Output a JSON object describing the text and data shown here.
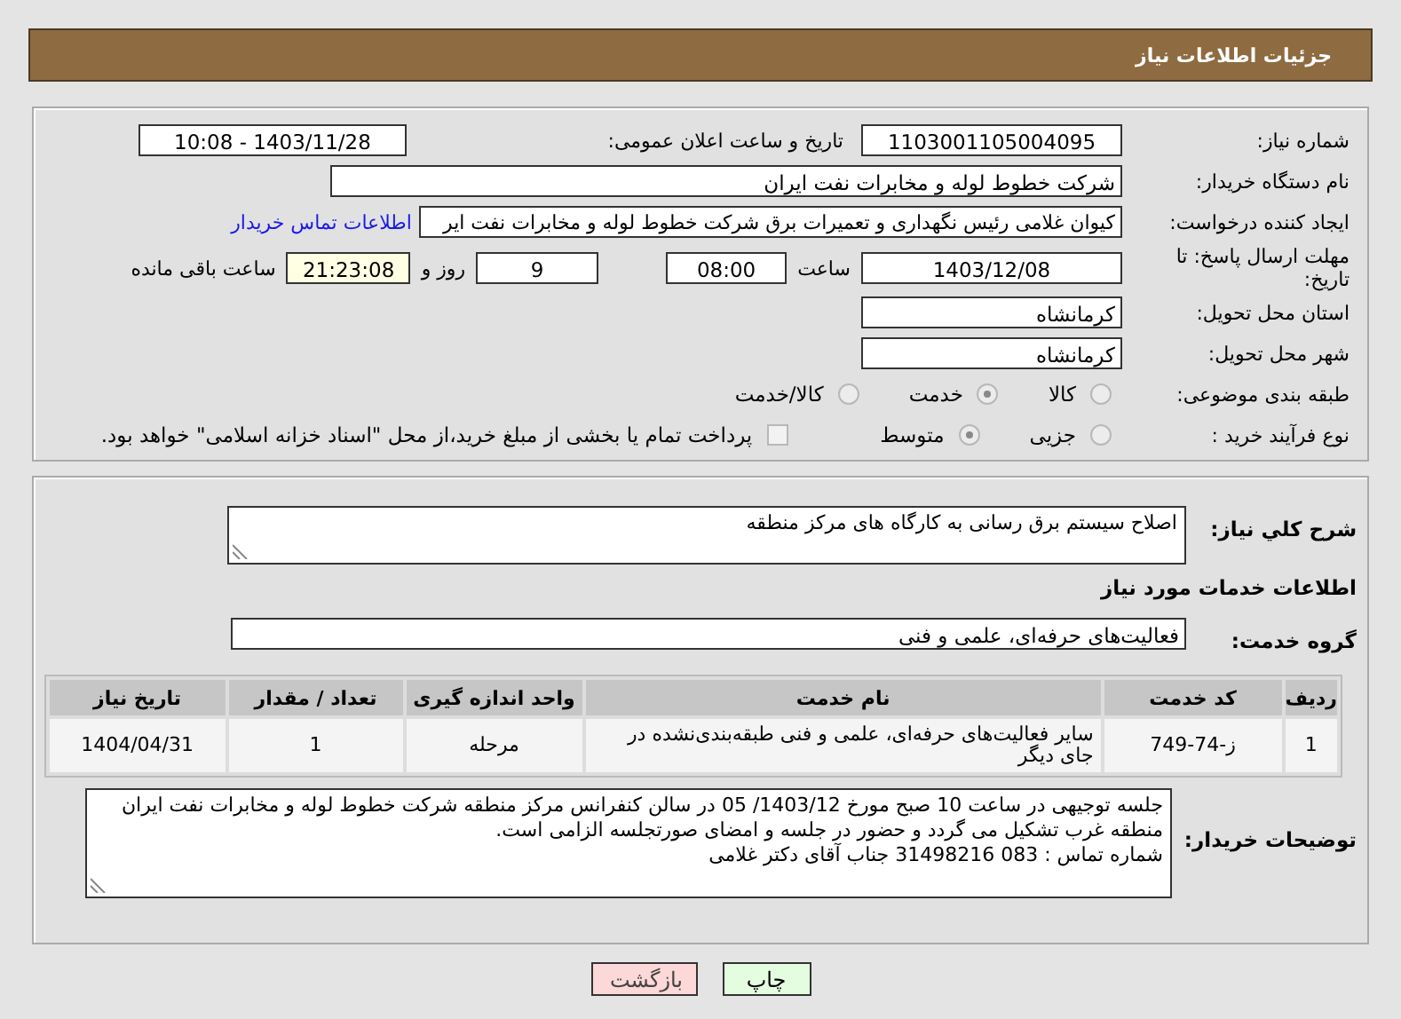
{
  "header": {
    "title": "جزئیات اطلاعات نیاز"
  },
  "need_number": {
    "label": "شماره نیاز:",
    "value": "1103001105004095"
  },
  "announce": {
    "label": "تاریخ و ساعت اعلان عمومی:",
    "value": "1403/11/28 - 10:08"
  },
  "buyer_org": {
    "label": "نام دستگاه خریدار:",
    "value": "شرکت خطوط لوله و مخابرات نفت ایران"
  },
  "requester": {
    "label": "ایجاد کننده درخواست:",
    "value": "کیوان غلامی رئیس نگهداری و تعمیرات برق شرکت خطوط لوله و مخابرات نفت ایر",
    "link": "اطلاعات تماس خریدار"
  },
  "deadline": {
    "label": "مهلت ارسال پاسخ: تا تاریخ:",
    "date": "1403/12/08",
    "time_label": "ساعت",
    "time": "08:00",
    "days": "9",
    "days_label": "روز و",
    "remaining": "21:23:08",
    "remaining_label": "ساعت باقی مانده"
  },
  "province": {
    "label": "استان محل تحویل:",
    "value": "کرمانشاه"
  },
  "city": {
    "label": "شهر محل تحویل:",
    "value": "کرمانشاه"
  },
  "category": {
    "label": "طبقه بندی موضوعی:",
    "options": [
      {
        "label": "کالا",
        "selected": false
      },
      {
        "label": "خدمت",
        "selected": true
      },
      {
        "label": "کالا/خدمت",
        "selected": false
      }
    ]
  },
  "process": {
    "label": "نوع فرآیند خرید :",
    "options": [
      {
        "label": "جزیی",
        "selected": false
      },
      {
        "label": "متوسط",
        "selected": true
      }
    ],
    "treasury": {
      "checked": false,
      "text": "پرداخت تمام یا بخشی از مبلغ خرید،از محل \"اسناد خزانه اسلامی\" خواهد بود."
    }
  },
  "summary": {
    "label": "شرح کلي نياز:",
    "value": "اصلاح سیستم برق رسانی به کارگاه های مرکز منطقه"
  },
  "services_heading": "اطلاعات خدمات مورد نیاز",
  "service_group": {
    "label": "گروه خدمت:",
    "value": "فعالیت‌های حرفه‌ای، علمی و فنی"
  },
  "table": {
    "columns": [
      "ردیف",
      "کد خدمت",
      "نام خدمت",
      "واحد اندازه گیری",
      "تعداد / مقدار",
      "تاریخ نیاز"
    ],
    "rows": [
      [
        "1",
        "ز-74-749",
        "سایر فعالیت‌های حرفه‌ای، علمی و فنی طبقه‌بندی‌نشده در جای دیگر",
        "مرحله",
        "1",
        "1404/04/31"
      ]
    ]
  },
  "buyer_notes": {
    "label": "توضیحات خریدار:",
    "value": "جلسه توجیهی در ساعت 10 صبح مورخ 1403/12/ 05 در سالن کنفرانس مرکز منطقه شرکت خطوط لوله و مخابرات نفت ایران منطقه غرب تشکیل می گردد و حضور در جلسه و امضای صورتجلسه الزامی است.\nشماره تماس : 083 31498216 جناب آقای دکتر غلامی"
  },
  "buttons": [
    {
      "label": "چاپ",
      "kind": "print"
    },
    {
      "label": "بازگشت",
      "kind": "back"
    }
  ]
}
